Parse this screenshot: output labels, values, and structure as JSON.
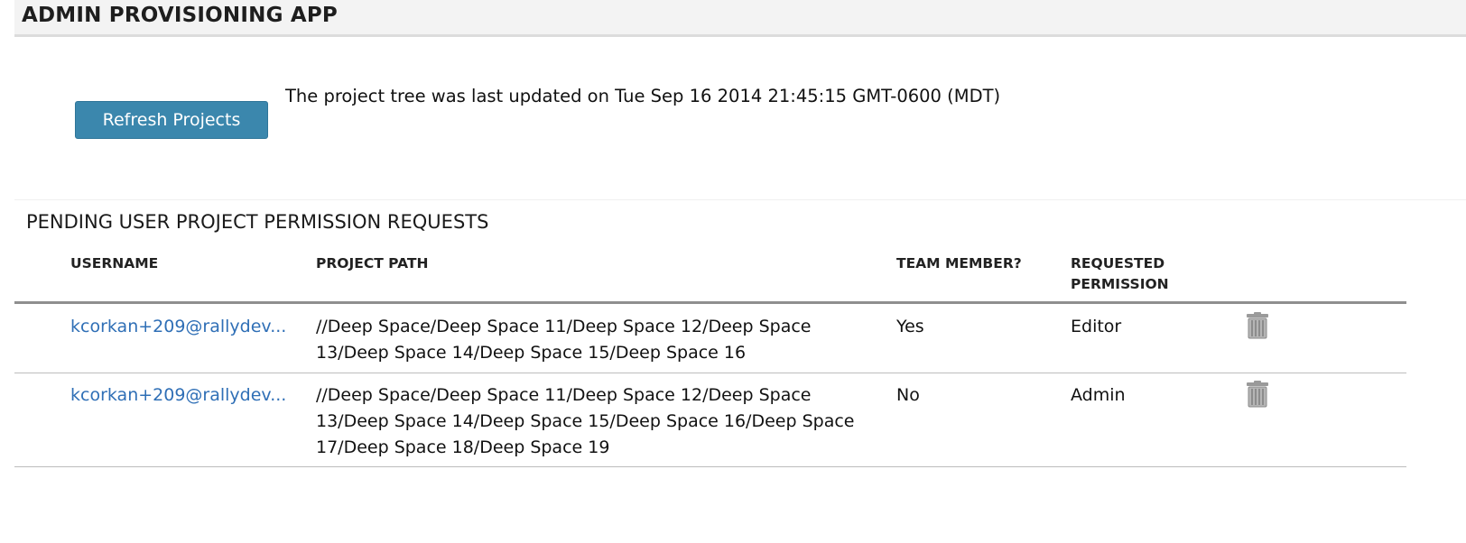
{
  "app": {
    "title": "ADMIN PROVISIONING APP"
  },
  "toolbar": {
    "refresh_label": "Refresh Projects",
    "last_updated_text": "The project tree was last updated on Tue Sep 16 2014 21:45:15 GMT-0600 (MDT)"
  },
  "requests": {
    "section_title": "PENDING USER PROJECT PERMISSION REQUESTS",
    "columns": {
      "username": "USERNAME",
      "project_path": "PROJECT PATH",
      "team_member": "TEAM MEMBER?",
      "requested_permission_line1": "REQUESTED",
      "requested_permission_line2": "PERMISSION"
    },
    "rows": [
      {
        "username": "kcorkan+209@rallydev...",
        "project_path": "//Deep Space/Deep Space 11/Deep Space 12/Deep Space 13/Deep Space 14/Deep Space 15/Deep Space 16",
        "team_member": "Yes",
        "permission": "Editor",
        "delete_icon": "trash-icon"
      },
      {
        "username": "kcorkan+209@rallydev...",
        "project_path": "//Deep Space/Deep Space 11/Deep Space 12/Deep Space 13/Deep Space 14/Deep Space 15/Deep Space 16/Deep Space 17/Deep Space 18/Deep Space 19",
        "team_member": "No",
        "permission": "Admin",
        "delete_icon": "trash-icon"
      }
    ]
  },
  "colors": {
    "button": "#3b87ad",
    "link": "#2f6fb6",
    "header_bg": "#f3f3f3"
  }
}
